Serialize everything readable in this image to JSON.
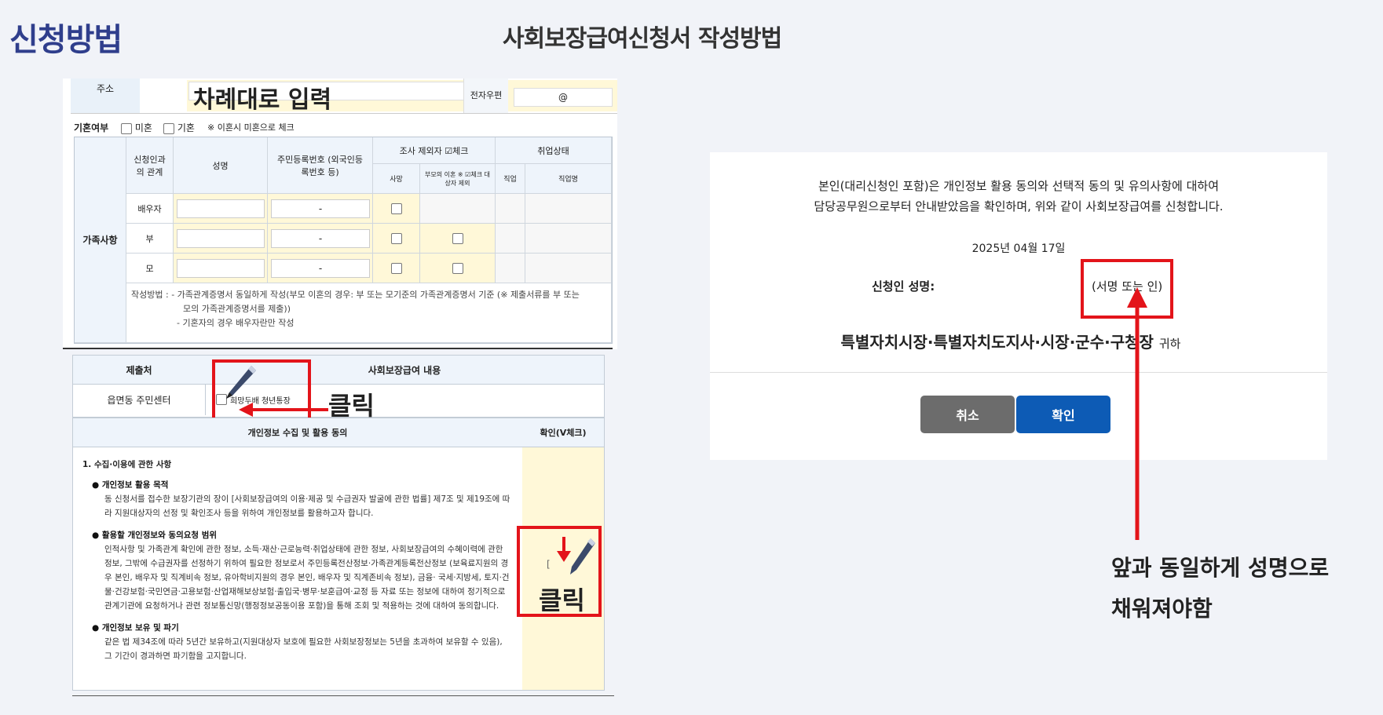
{
  "page": {
    "title_left": "신청방법",
    "title_center": "사회보장급여신청서 작성방법"
  },
  "form_family": {
    "address_label": "주소",
    "address_overlay": "차례대로 입력",
    "email_label": "전자우편",
    "email_value": "@",
    "marriage": {
      "label": "기혼여부",
      "opt1": "미혼",
      "opt2": "기혼",
      "note": "※ 이혼시 미혼으로 체크"
    },
    "section_label": "가족사항",
    "headers": {
      "relation": "신청인과의 관계",
      "name": "성명",
      "rrn": "주민등록번호 (외국인등록번호 등)",
      "exclude": "조사 제외자 ☑체크",
      "death": "사망",
      "divorce": "부모의 이혼 ※ ☑체크 대상자 제외",
      "job_status": "취업상태",
      "job": "직업",
      "job_name": "직업명"
    },
    "rows": [
      {
        "rel": "배우자",
        "rrn": "-"
      },
      {
        "rel": "부",
        "rrn": "-"
      },
      {
        "rel": "모",
        "rrn": "-"
      }
    ],
    "notes": {
      "label": "작성방법 :",
      "line1": "- 가족관계증명서 동일하게 작성(부모 이혼의 경우: 부 또는 모기준의 가족관계증명서 기준 (※ 제출서류를 부 또는",
      "line2": "모의 가족관계증명서를 제출))",
      "line3": "- 기혼자의 경우 배우자란만 작성"
    }
  },
  "submit_table": {
    "h1": "제출처",
    "h2": "사회보장급여 내용",
    "place": "읍면동 주민센터",
    "benefit": "희망두배 청년통장",
    "click": "클릭"
  },
  "consent": {
    "header": "개인정보 수집 및 활용 동의",
    "check_header": "확인(V체크)",
    "s1": "1. 수집·이용에 관한 사항",
    "b1_title": "● 개인정보 활용 목적",
    "b1_text": "동 신청서를 접수한 보장기관의 장이 [사회보장급여의 이용·제공 및 수급권자 발굴에 관한 법률] 제7조 및 제19조에 따라 지원대상자의 선정 및 확인조사 등을 위하여 개인정보를 활용하고자 합니다.",
    "b2_title": "● 활용할 개인정보와 동의요청 범위",
    "b2_text": "인적사항 및 가족관계 확인에 관한 정보, 소득·재산·근로능력·취업상태에 관한 정보, 사회보장급여의 수혜이력에 관한 정보, 그밖에 수급권자를 선정하기 위하여 필요한 정보로서 주민등록전산정보·가족관계등록전산정보 (보육료지원의 경우 본인, 배우자 및 직계비속 정보, 유아학비지원의 경우 본인, 배우자 및 직계존비속 정보), 금융· 국세·지방세, 토지·건물·건강보험·국민연금·고용보험·산업재해보상보험·출입국·병무·보훈급여·교정 등 자료 또는 정보에 대하여 정기적으로 관계기관에 요청하거나 관련 정보통신망(행정정보공동이용 포함)을 통해 조회 및 적용하는 것에 대하여 동의합니다.",
    "b3_title": "● 개인정보 보유 및 파기",
    "b3_text": "같은 법 제34조에 따라 5년간 보유하고(지원대상자 보호에 필요한 사회보장정보는 5년을 초과하여 보유할 수 있음), 그 기간이 경과하면 파기함을 고지합니다.",
    "click": "클릭",
    "bracket": "["
  },
  "dialog": {
    "line1": "본인(대리신청인 포함)은 개인정보 활용 동의와 선택적 동의 및 유의사항에 대하여",
    "line2": "담당공무원으로부터 안내받았음을 확인하며, 위와 같이 사회보장급여를 신청합니다.",
    "date": "2025년 04월 17일",
    "name_label": "신청인 성명:",
    "sign": "(서명 또는 인)",
    "recipient": "특별자치시장·특별자치도지사·시장·군수·구청장",
    "recipient_suffix": "귀하",
    "cancel": "취소",
    "confirm": "확인"
  },
  "annotation": {
    "line1": "앞과 동일하게 성명으로",
    "line2": "채워져야함"
  },
  "colors": {
    "accent": "#0d5bb5",
    "red": "#e3141a",
    "cancel": "#6c6c6c",
    "title": "#2f3e8c"
  }
}
